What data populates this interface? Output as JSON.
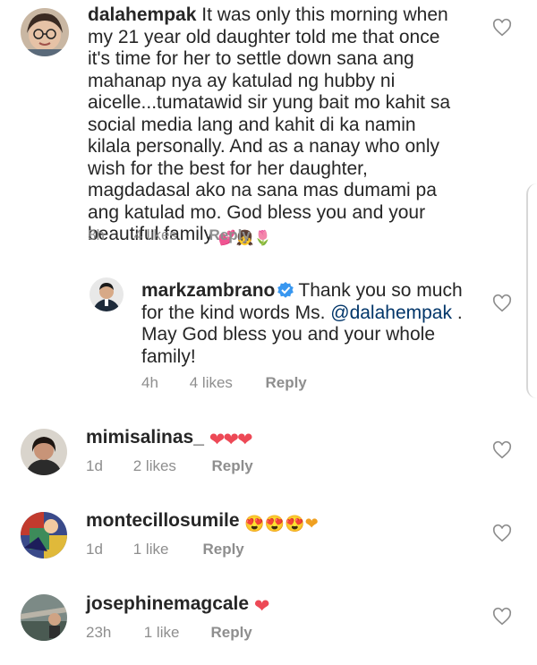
{
  "comments": [
    {
      "username": "dalahempak",
      "text": "It was only this morning when my 21 year old daughter told me that once it's time for her to settle down sana ang mahanap nya ay katulad ng hubby ni aicelle...tumatawid sir yung bait mo kahit sa social media lang and kahit di ka namin kilala personally.  And as a nanay who only wish for the best for her daughter, magdadasal ako na sana mas dumami pa ang katulad mo.  God bless you and your beautiful family",
      "emojis": "💕👧🌷",
      "time": "8h",
      "likes": "4 likes",
      "reply": "Reply"
    },
    {
      "username": "markzambrano",
      "text_before": "Thank you so much for the kind words Ms. ",
      "mention": "@dalahempak",
      "text_after": " . May God bless you and your whole family!",
      "time": "4h",
      "likes": "4 likes",
      "reply": "Reply"
    },
    {
      "username": "mimisalinas_",
      "emojis": "❤❤❤",
      "time": "1d",
      "likes": "2 likes",
      "reply": "Reply"
    },
    {
      "username": "montecillosumile",
      "emojis": "😍😍😍❤",
      "time": "1d",
      "likes": "1 like",
      "reply": "Reply"
    },
    {
      "username": "josephinemagcale",
      "emojis": "❤",
      "time": "23h",
      "likes": "1 like",
      "reply": "Reply"
    }
  ],
  "colors": {
    "text": "#262626",
    "meta": "#8e8e8e",
    "verified": "#3897f0",
    "heart_emoji": "#ed4956",
    "mention": "#003569"
  },
  "icons": [
    "heart-outline-icon",
    "verified-badge-icon"
  ]
}
